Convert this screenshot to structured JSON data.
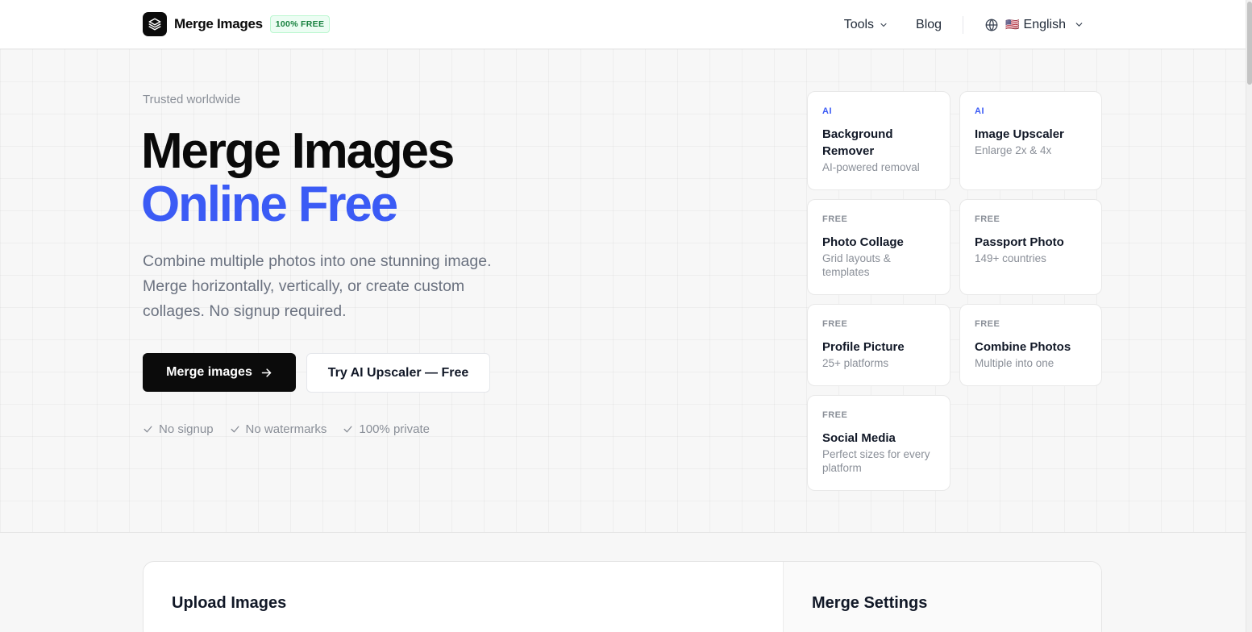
{
  "header": {
    "brand_name": "Merge Images",
    "badge": "100% FREE",
    "nav": {
      "tools": "Tools",
      "blog": "Blog",
      "flag": "🇺🇸",
      "language": "English"
    }
  },
  "hero": {
    "eyebrow": "Trusted worldwide",
    "title_line1": "Merge Images",
    "title_line2": "Online Free",
    "lead": "Combine multiple photos into one stunning image. Merge horizontally, vertically, or create custom collages. No signup required.",
    "cta_primary": "Merge images",
    "cta_secondary": "Try AI Upscaler — Free",
    "checks": [
      "No signup",
      "No watermarks",
      "100% private"
    ]
  },
  "tool_cards": [
    {
      "tag": "AI",
      "title": "Background Remover",
      "sub": "AI-powered removal"
    },
    {
      "tag": "AI",
      "title": "Image Upscaler",
      "sub": "Enlarge 2x & 4x"
    },
    {
      "tag": "FREE",
      "title": "Photo Collage",
      "sub": "Grid layouts & templates"
    },
    {
      "tag": "FREE",
      "title": "Passport Photo",
      "sub": "149+ countries"
    },
    {
      "tag": "FREE",
      "title": "Profile Picture",
      "sub": "25+ platforms"
    },
    {
      "tag": "FREE",
      "title": "Combine Photos",
      "sub": "Multiple into one"
    },
    {
      "tag": "FREE",
      "title": "Social Media",
      "sub": "Perfect sizes for every platform"
    }
  ],
  "panel": {
    "upload_title": "Upload Images",
    "settings_title": "Merge Settings"
  },
  "colors": {
    "accent": "#3b5bf5",
    "primary_button": "#0b0b0b",
    "badge_green": "#15803d"
  },
  "icons": {
    "logo": "layers-icon",
    "language": "globe-icon",
    "dropdown": "chevron-down-icon",
    "cta_arrow": "arrow-right-icon",
    "check": "check-icon"
  }
}
